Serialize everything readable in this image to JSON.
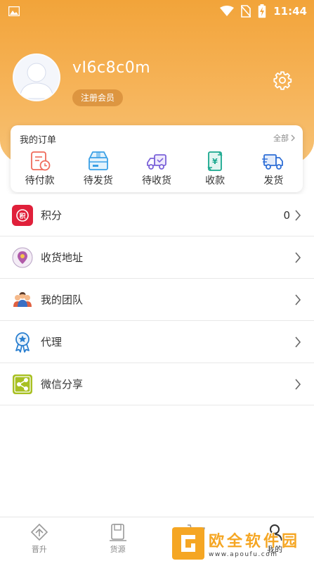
{
  "status_bar": {
    "time": "11:44"
  },
  "profile": {
    "username": "vI6c8c0m",
    "member_badge": "注册会员"
  },
  "orders": {
    "title": "我的订单",
    "all_label": "全部",
    "items": [
      {
        "label": "待付款",
        "icon": "pending-payment-icon"
      },
      {
        "label": "待发货",
        "icon": "pending-shipment-icon"
      },
      {
        "label": "待收货",
        "icon": "pending-receipt-icon"
      },
      {
        "label": "收款",
        "icon": "receive-payment-icon"
      },
      {
        "label": "发货",
        "icon": "ship-icon"
      }
    ]
  },
  "menu": {
    "items": [
      {
        "label": "积分",
        "value": "0",
        "icon": "points-icon"
      },
      {
        "label": "收货地址",
        "icon": "address-pin-icon"
      },
      {
        "label": "我的团队",
        "icon": "team-icon"
      },
      {
        "label": "代理",
        "icon": "agent-badge-icon"
      },
      {
        "label": "微信分享",
        "icon": "share-icon"
      }
    ]
  },
  "bottom_nav": {
    "items": [
      {
        "label": "晋升",
        "icon": "promote-icon"
      },
      {
        "label": "货源",
        "icon": "goods-source-icon"
      },
      {
        "label": "",
        "icon": "cart-icon"
      },
      {
        "label": "我的",
        "icon": "profile-icon",
        "active": true
      }
    ]
  },
  "watermark": {
    "title": "欧全软件园",
    "url": "www.apoufu.com"
  },
  "colors": {
    "header_top": "#f2a43a",
    "header_bottom": "#f7c377",
    "order_red": "#ef6b5b",
    "order_blue": "#3aa0e6",
    "order_purple": "#7b62d9",
    "order_teal": "#1aa88f",
    "order_navy": "#2f6fd6"
  }
}
